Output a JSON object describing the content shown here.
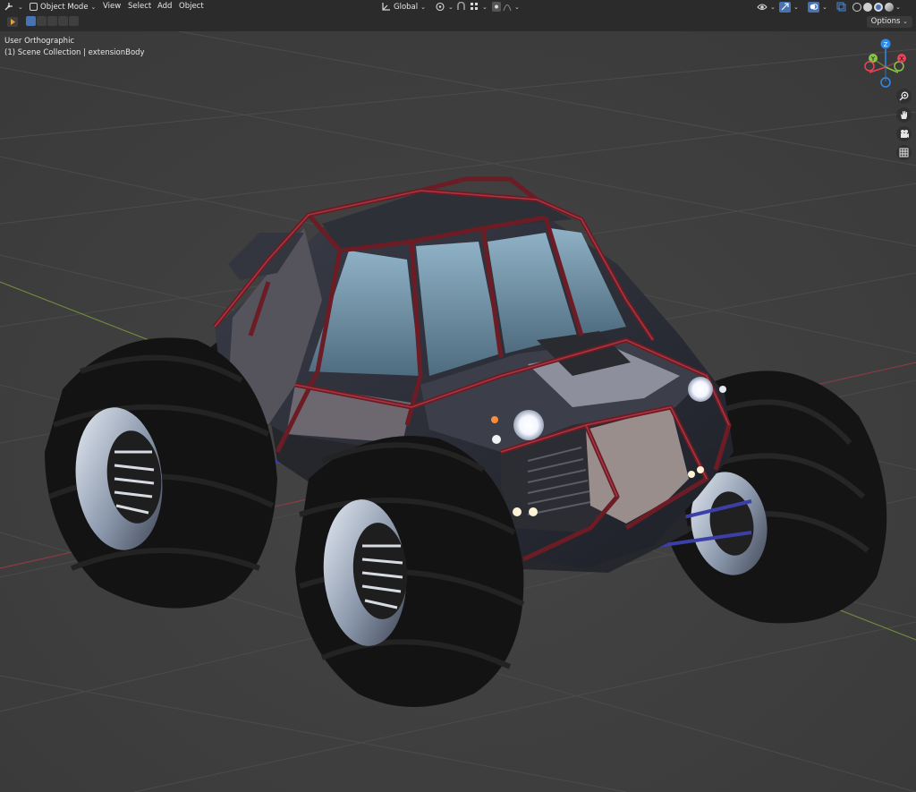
{
  "header": {
    "mode_label": "Object Mode",
    "menus": [
      "View",
      "Select",
      "Add",
      "Object"
    ],
    "transform_orientation": "Global"
  },
  "toolbar": {
    "options_label": "Options"
  },
  "viewport": {
    "view_name": "User Orthographic",
    "collection_info": "(1) Scene Collection | extensionBody",
    "gizmo": {
      "z": "Z",
      "y": "Y",
      "x": "X"
    }
  },
  "icons": {
    "editor_type": "editor-type-icon",
    "mode": "object-mode-icon",
    "orientation": "transform-orientation-icon",
    "pivot": "pivot-icon",
    "snap": "snap-icon",
    "proportional": "proportional-edit-icon",
    "visibility": "visibility-icon",
    "gizmo": "gizmo-icon",
    "overlay": "overlay-icon",
    "xray": "xray-icon",
    "zoom": "zoom-icon",
    "pan": "hand-icon",
    "camera": "camera-icon",
    "grid": "grid-icon"
  },
  "colors": {
    "header_bg": "#2b2b2b",
    "viewport_bg": "#3e3e3e",
    "accent": "#4772b3",
    "axis_x": "#e5445a",
    "axis_y": "#8bc34a",
    "axis_z": "#2d8ceb"
  }
}
